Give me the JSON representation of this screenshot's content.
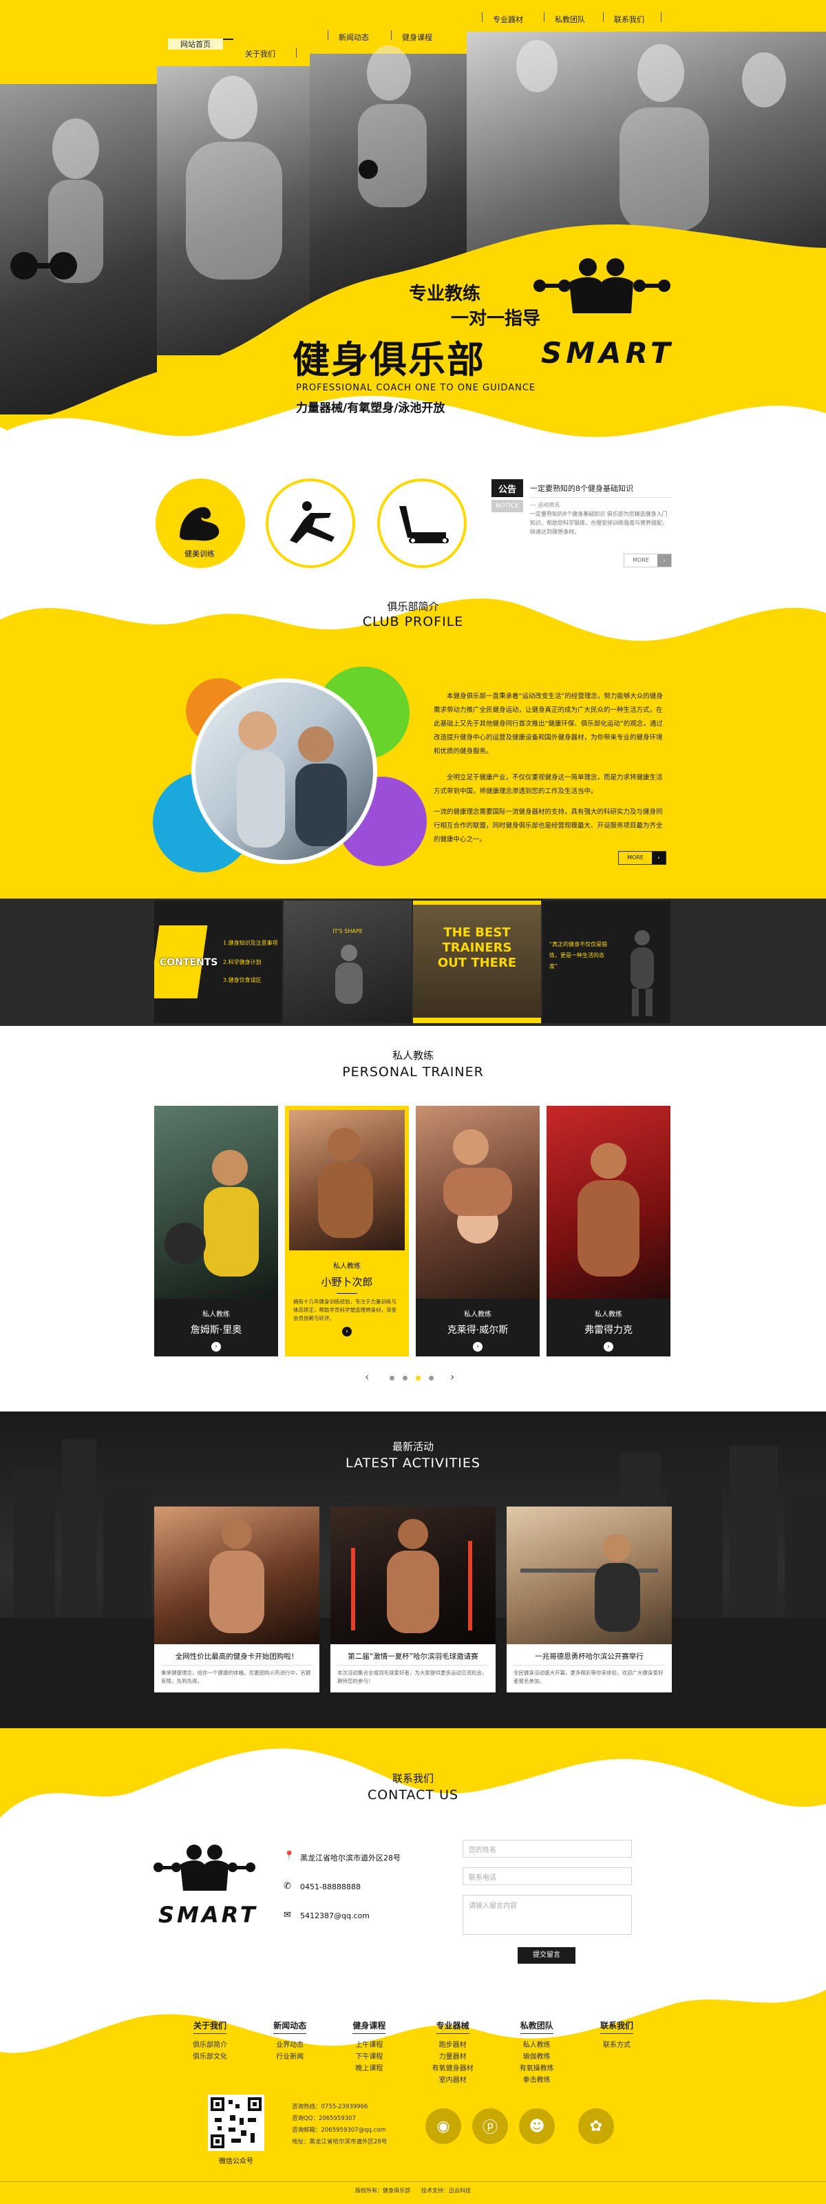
{
  "nav": {
    "items": [
      "网站首页",
      "关于我们",
      "新闻动态",
      "健身课程",
      "专业器材",
      "私教团队",
      "联系我们"
    ]
  },
  "hero": {
    "slogan1": "专业教练",
    "slogan2": "一对一指导",
    "title": "健身俱乐部",
    "subtitle_en": "PROFESSIONAL COACH ONE TO ONE GUIDANCE",
    "tagline": "力量器械/有氧塑身/泳池开放",
    "brand": "SMART"
  },
  "services": {
    "items": [
      {
        "label": "健美训练",
        "icon": "muscle-arm-icon"
      },
      {
        "label": "",
        "icon": "yoga-pose-icon"
      },
      {
        "label": "",
        "icon": "treadmill-icon"
      }
    ]
  },
  "notice": {
    "tag1": "公告",
    "tag2": "NOTICE",
    "headline": "一定要熟知的8个健身基础知识",
    "line1": "--- 运动资讯",
    "body": "一定要熟知的8个健身基础知识 俱乐部为您精选健身入门知识，帮助您科学锻炼，合理安排训练强度与营养搭配，快速达到理想身材。",
    "more": "MORE"
  },
  "club": {
    "title_cn": "俱乐部简介",
    "title_en": "CLUB PROFILE",
    "para1": "本健身俱乐部一直秉承着“运动改变生活”的经营理念，努力能够大众的健身需求带动力推广全民健身运动，让健身真正的成为广大民众的一种生活方式，在此基础上又先于其他健身同行首次推出“健康环保、俱乐部化运动”的观念，通过改造提升健身中心的运营及健康设备和国外健身器材，为你带来专业的健身环境和优质的健身服务。",
    "para2": "全明立足于健康产业，不仅仅重视健身这一简单理念，而是力求将健康生活方式带到中国，将健康理念渗透到您的工作及生活当中。",
    "para3": "一流的健康理念需要国际一流健身器材的支持，具有强大的科研实力及与健身同行相互合作的联盟，同时健身俱乐部也是经营规模最大、开设服务项目最为齐全的健康中心之一。",
    "more": "MORE"
  },
  "strip": {
    "contents": "CONTENTS",
    "list": [
      "1.健身知识及注意事项",
      "2.科学健身计划",
      "3.健身饮食误区"
    ],
    "caption2": "IT'S SHAPE",
    "best1": "THE BEST",
    "best2": "TRAINERS",
    "best3": "OUT THERE",
    "quote": "“真正的健身不仅仅是锻炼，更是一种生活的态度”"
  },
  "trainers": {
    "title_cn": "私人教练",
    "title_en": "PERSONAL TRAINER",
    "role": "私人教练",
    "names": [
      "詹姆斯·里奥",
      "小野卜次郎",
      "克莱得·威尔斯",
      "弗雷得力克"
    ],
    "featured_desc": "拥有十几年健身训练经验，专注于力量训练与体态矫正，帮助学员科学塑造理想身材，深受会员信赖与好评。"
  },
  "activities": {
    "title_cn": "最新活动",
    "title_en": "LATEST ACTIVITIES",
    "items": [
      {
        "title": "全网性价比最高的健身卡开始团购啦！",
        "desc": "秉承健康理念，给你一个健康的体魄。优惠团购火热进行中，名额有限，先到先得。"
      },
      {
        "title": "第二届“激情一夏杯”哈尔滨羽毛球邀请赛",
        "desc": "本次活动集合全城羽毛球爱好者，为大家提供更多运动交流机会，期待您的参与！"
      },
      {
        "title": "一兆哥德恩勇杯哈尔滨公开赛举行",
        "desc": "全民健身活动盛大开幕，更多精彩等你来体验，欢迎广大健身爱好者报名参加。"
      }
    ]
  },
  "contact": {
    "title_cn": "联系我们",
    "title_en": "CONTACT US",
    "address": "黑龙江省哈尔滨市道外区28号",
    "phone": "0451-88888888",
    "email": "5412387@qq.com",
    "ph_name": "您的姓名",
    "ph_phone": "联系电话",
    "ph_msg": "请输入留言内容",
    "submit": "提交留言"
  },
  "footer": {
    "cols": [
      {
        "h": "关于我们",
        "items": [
          "俱乐部简介",
          "俱乐部文化"
        ]
      },
      {
        "h": "新闻动态",
        "items": [
          "业界动态",
          "行业新闻"
        ]
      },
      {
        "h": "健身课程",
        "items": [
          "上午课程",
          "下午课程",
          "晚上课程"
        ]
      },
      {
        "h": "专业器械",
        "items": [
          "跑步器材",
          "力量器材",
          "有氧健身器材",
          "室内器材"
        ]
      },
      {
        "h": "私教团队",
        "items": [
          "私人教练",
          "瑜伽教练",
          "有氧操教练",
          "拳击教练"
        ]
      },
      {
        "h": "联系我们",
        "items": [
          "联系方式"
        ]
      }
    ],
    "qr_label": "微信公众号",
    "info": [
      "咨询热线：0755-23939966",
      "咨询QQ：2065959307",
      "咨询邮箱：2065959307@qq.com",
      "地址：黑龙江省哈尔滨市道外区28号"
    ],
    "social": [
      "weibo-icon",
      "pinterest-icon",
      "qq-icon",
      "paw-icon"
    ],
    "copyright": "版权所有：健身俱乐部　　技术支持：迅云科技"
  },
  "colors": {
    "accent": "#ffd800",
    "dark": "#1b1b1b"
  }
}
